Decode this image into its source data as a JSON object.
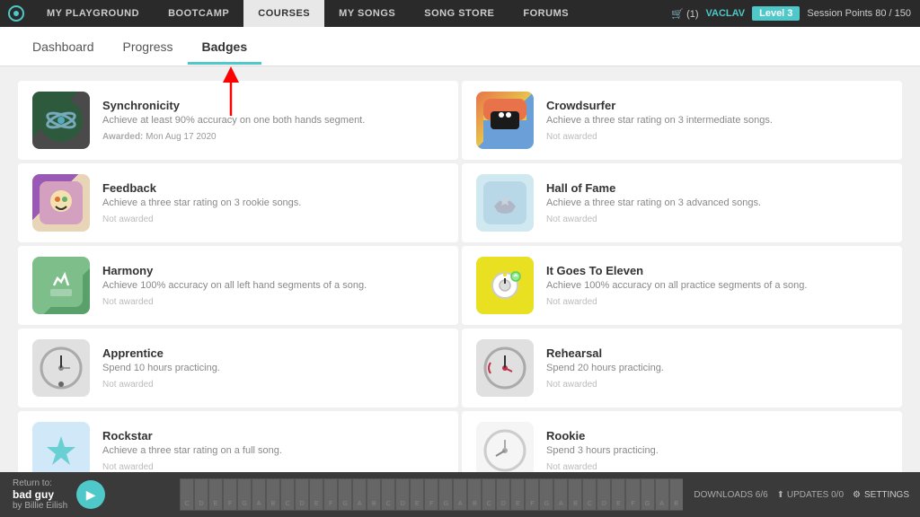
{
  "nav": {
    "logo": "P",
    "items": [
      {
        "label": "MY PLAYGROUND",
        "active": false
      },
      {
        "label": "BOOTCAMP",
        "active": false
      },
      {
        "label": "COURSES",
        "active": true
      },
      {
        "label": "MY SONGS",
        "active": false
      },
      {
        "label": "SONG STORE",
        "active": false
      },
      {
        "label": "FORUMS",
        "active": false
      }
    ],
    "cart": "(1)",
    "user": "VACLAV",
    "level": "Level 3",
    "session": "Session Points 80 / 150"
  },
  "subnav": {
    "items": [
      {
        "label": "Dashboard",
        "active": false
      },
      {
        "label": "Progress",
        "active": false
      },
      {
        "label": "Badges",
        "active": true
      }
    ]
  },
  "badges": [
    {
      "id": "synchronicity",
      "name": "Synchronicity",
      "desc": "Achieve at least 90% accuracy on one both hands segment.",
      "awarded": true,
      "award_text": "Awarded:",
      "award_date": "Mon Aug 17 2020"
    },
    {
      "id": "crowdsurfer",
      "name": "Crowdsurfer",
      "desc": "Achieve a three star rating on 3 intermediate songs.",
      "awarded": false,
      "not_awarded": "Not awarded"
    },
    {
      "id": "feedback",
      "name": "Feedback",
      "desc": "Achieve a three star rating on 3 rookie songs.",
      "awarded": false,
      "not_awarded": "Not awarded"
    },
    {
      "id": "halloffame",
      "name": "Hall of Fame",
      "desc": "Achieve a three star rating on 3 advanced songs.",
      "awarded": false,
      "not_awarded": "Not awarded"
    },
    {
      "id": "harmony",
      "name": "Harmony",
      "desc": "Achieve 100% accuracy on all left hand segments of a song.",
      "awarded": false,
      "not_awarded": "Not awarded"
    },
    {
      "id": "itgoestoeleven",
      "name": "It Goes To Eleven",
      "desc": "Achieve 100% accuracy on all practice segments of a song.",
      "awarded": false,
      "not_awarded": "Not awarded"
    },
    {
      "id": "apprentice",
      "name": "Apprentice",
      "desc": "Spend 10 hours practicing.",
      "awarded": false,
      "not_awarded": "Not awarded"
    },
    {
      "id": "rehearsal",
      "name": "Rehearsal",
      "desc": "Spend 20 hours practicing.",
      "awarded": false,
      "not_awarded": "Not awarded"
    },
    {
      "id": "rockstar",
      "name": "Rockstar",
      "desc": "Achieve a three star rating on a full song.",
      "awarded": false,
      "not_awarded": "Not awarded"
    },
    {
      "id": "rookie",
      "name": "Rookie",
      "desc": "Spend 3 hours practicing.",
      "awarded": false,
      "not_awarded": "Not awarded"
    }
  ],
  "bottom": {
    "return_to": "Return to:",
    "song_name": "bad guy",
    "artist": "by Billie Eilish",
    "downloads": "DOWNLOADS 6/6",
    "updates": "UPDATES 0/0",
    "settings": "SETTINGS"
  }
}
